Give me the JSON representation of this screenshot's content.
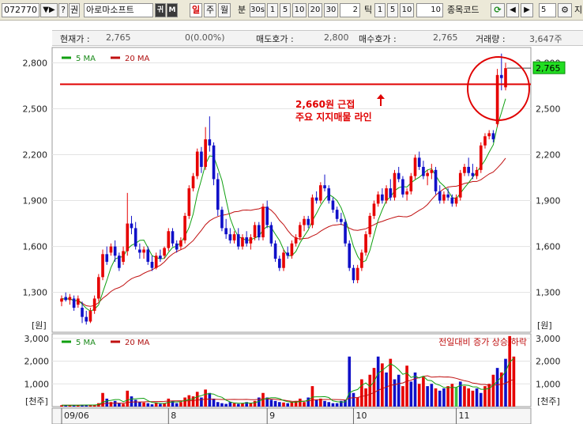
{
  "toolbar": {
    "code": "072770",
    "arrows": "▼▶",
    "help": "?",
    "right_btn": "권",
    "stock_name": "아로마소프트",
    "mode_btn": "귀",
    "menu_btn": "M",
    "period_day": "일",
    "period_week": "주",
    "period_month": "월",
    "minute_label": "분",
    "minute_options": [
      "30s",
      "1",
      "5",
      "10",
      "20",
      "30"
    ],
    "minute_value": "2",
    "tick_label": "틱",
    "tick_options": [
      "1",
      "5",
      "10"
    ],
    "tick_value": "10",
    "compare_label": "종목코드",
    "count_value": "5",
    "right_edge_label": "지"
  },
  "info": {
    "price_label": "현재가 :",
    "price": "2,765",
    "change": "0(0.00%)",
    "ask_label": "매도호가 :",
    "ask": "2,800",
    "bid_label": "매수호가 :",
    "bid": "2,765",
    "volume_label": "거래량 :",
    "volume": "3,647주"
  },
  "chart_data": [
    {
      "type": "candlestick",
      "legend": [
        "5 MA",
        "20 MA"
      ],
      "y_ticks": [
        "2,800",
        "2,500",
        "2,200",
        "1,900",
        "1,600",
        "1,300"
      ],
      "y_unit": "[원]",
      "ylim": [
        1040,
        2900
      ],
      "x_ticks": [
        "09/06",
        "8",
        "9",
        "10",
        "11"
      ],
      "last_price_tag": "2,765",
      "support_level": 2660,
      "annotation": [
        "2,660원 근접",
        "주요 지지매물 라인"
      ],
      "colors": {
        "up": "#e60000",
        "down": "#1010c8",
        "ma5": "#10a010",
        "ma20": "#c01010",
        "support": "#e00000",
        "tag_bg": "#22dd22"
      },
      "candles": [
        {
          "o": 1240,
          "h": 1280,
          "l": 1210,
          "c": 1260
        },
        {
          "o": 1270,
          "h": 1300,
          "l": 1240,
          "c": 1250
        },
        {
          "o": 1250,
          "h": 1290,
          "l": 1220,
          "c": 1270
        },
        {
          "o": 1260,
          "h": 1280,
          "l": 1180,
          "c": 1200
        },
        {
          "o": 1220,
          "h": 1280,
          "l": 1200,
          "c": 1260
        },
        {
          "o": 1200,
          "h": 1240,
          "l": 1100,
          "c": 1140
        },
        {
          "o": 1140,
          "h": 1180,
          "l": 1090,
          "c": 1110
        },
        {
          "o": 1110,
          "h": 1200,
          "l": 1100,
          "c": 1180
        },
        {
          "o": 1180,
          "h": 1280,
          "l": 1160,
          "c": 1260
        },
        {
          "o": 1260,
          "h": 1420,
          "l": 1240,
          "c": 1400
        },
        {
          "o": 1400,
          "h": 1580,
          "l": 1380,
          "c": 1550
        },
        {
          "o": 1550,
          "h": 1600,
          "l": 1480,
          "c": 1500
        },
        {
          "o": 1560,
          "h": 1620,
          "l": 1540,
          "c": 1600
        },
        {
          "o": 1600,
          "h": 1640,
          "l": 1500,
          "c": 1540
        },
        {
          "o": 1540,
          "h": 1560,
          "l": 1440,
          "c": 1460
        },
        {
          "o": 1500,
          "h": 1600,
          "l": 1480,
          "c": 1570
        },
        {
          "o": 1570,
          "h": 1950,
          "l": 1540,
          "c": 1750
        },
        {
          "o": 1750,
          "h": 1800,
          "l": 1680,
          "c": 1720
        },
        {
          "o": 1720,
          "h": 1760,
          "l": 1580,
          "c": 1600
        },
        {
          "o": 1580,
          "h": 1620,
          "l": 1520,
          "c": 1560
        },
        {
          "o": 1560,
          "h": 1600,
          "l": 1520,
          "c": 1580
        },
        {
          "o": 1580,
          "h": 1600,
          "l": 1480,
          "c": 1500
        },
        {
          "o": 1500,
          "h": 1540,
          "l": 1440,
          "c": 1460
        },
        {
          "o": 1460,
          "h": 1560,
          "l": 1450,
          "c": 1540
        },
        {
          "o": 1540,
          "h": 1580,
          "l": 1500,
          "c": 1520
        },
        {
          "o": 1540,
          "h": 1600,
          "l": 1520,
          "c": 1590
        },
        {
          "o": 1590,
          "h": 1720,
          "l": 1570,
          "c": 1700
        },
        {
          "o": 1700,
          "h": 1720,
          "l": 1600,
          "c": 1620
        },
        {
          "o": 1620,
          "h": 1640,
          "l": 1560,
          "c": 1580
        },
        {
          "o": 1600,
          "h": 1660,
          "l": 1580,
          "c": 1640
        },
        {
          "o": 1640,
          "h": 1820,
          "l": 1620,
          "c": 1800
        },
        {
          "o": 1800,
          "h": 2000,
          "l": 1780,
          "c": 1980
        },
        {
          "o": 1980,
          "h": 2080,
          "l": 1960,
          "c": 2060
        },
        {
          "o": 2060,
          "h": 2240,
          "l": 2040,
          "c": 2220
        },
        {
          "o": 2220,
          "h": 2250,
          "l": 2080,
          "c": 2120
        },
        {
          "o": 2120,
          "h": 2380,
          "l": 2100,
          "c": 2300
        },
        {
          "o": 2300,
          "h": 2450,
          "l": 2220,
          "c": 2260
        },
        {
          "o": 2260,
          "h": 2280,
          "l": 2000,
          "c": 2040
        },
        {
          "o": 2040,
          "h": 2080,
          "l": 1800,
          "c": 1840
        },
        {
          "o": 1840,
          "h": 1860,
          "l": 1700,
          "c": 1720
        },
        {
          "o": 1720,
          "h": 1780,
          "l": 1650,
          "c": 1680
        },
        {
          "o": 1680,
          "h": 1720,
          "l": 1620,
          "c": 1640
        },
        {
          "o": 1640,
          "h": 1700,
          "l": 1620,
          "c": 1680
        },
        {
          "o": 1680,
          "h": 1720,
          "l": 1580,
          "c": 1600
        },
        {
          "o": 1600,
          "h": 1680,
          "l": 1580,
          "c": 1660
        },
        {
          "o": 1660,
          "h": 1700,
          "l": 1600,
          "c": 1620
        },
        {
          "o": 1620,
          "h": 1680,
          "l": 1580,
          "c": 1660
        },
        {
          "o": 1660,
          "h": 1760,
          "l": 1640,
          "c": 1740
        },
        {
          "o": 1740,
          "h": 1760,
          "l": 1640,
          "c": 1660
        },
        {
          "o": 1660,
          "h": 1880,
          "l": 1640,
          "c": 1860
        },
        {
          "o": 1860,
          "h": 1900,
          "l": 1720,
          "c": 1740
        },
        {
          "o": 1740,
          "h": 1760,
          "l": 1600,
          "c": 1620
        },
        {
          "o": 1620,
          "h": 1640,
          "l": 1500,
          "c": 1520
        },
        {
          "o": 1520,
          "h": 1540,
          "l": 1440,
          "c": 1460
        },
        {
          "o": 1460,
          "h": 1580,
          "l": 1440,
          "c": 1560
        },
        {
          "o": 1560,
          "h": 1600,
          "l": 1520,
          "c": 1540
        },
        {
          "o": 1540,
          "h": 1640,
          "l": 1520,
          "c": 1620
        },
        {
          "o": 1620,
          "h": 1680,
          "l": 1600,
          "c": 1660
        },
        {
          "o": 1660,
          "h": 1760,
          "l": 1640,
          "c": 1740
        },
        {
          "o": 1740,
          "h": 1800,
          "l": 1700,
          "c": 1780
        },
        {
          "o": 1780,
          "h": 1800,
          "l": 1720,
          "c": 1740
        },
        {
          "o": 1740,
          "h": 1940,
          "l": 1720,
          "c": 1920
        },
        {
          "o": 1920,
          "h": 1960,
          "l": 1880,
          "c": 1900
        },
        {
          "o": 1900,
          "h": 2020,
          "l": 1880,
          "c": 2000
        },
        {
          "o": 2000,
          "h": 2070,
          "l": 1960,
          "c": 1980
        },
        {
          "o": 1980,
          "h": 2000,
          "l": 1880,
          "c": 1900
        },
        {
          "o": 1900,
          "h": 1920,
          "l": 1820,
          "c": 1840
        },
        {
          "o": 1840,
          "h": 1860,
          "l": 1760,
          "c": 1780
        },
        {
          "o": 1780,
          "h": 1820,
          "l": 1740,
          "c": 1760
        },
        {
          "o": 1760,
          "h": 1780,
          "l": 1600,
          "c": 1620
        },
        {
          "o": 1620,
          "h": 1640,
          "l": 1440,
          "c": 1460
        },
        {
          "o": 1460,
          "h": 1480,
          "l": 1360,
          "c": 1380
        },
        {
          "o": 1380,
          "h": 1480,
          "l": 1360,
          "c": 1460
        },
        {
          "o": 1460,
          "h": 1580,
          "l": 1440,
          "c": 1560
        },
        {
          "o": 1560,
          "h": 1700,
          "l": 1540,
          "c": 1680
        },
        {
          "o": 1680,
          "h": 1820,
          "l": 1660,
          "c": 1800
        },
        {
          "o": 1800,
          "h": 1900,
          "l": 1780,
          "c": 1880
        },
        {
          "o": 1880,
          "h": 1960,
          "l": 1860,
          "c": 1940
        },
        {
          "o": 1940,
          "h": 1980,
          "l": 1880,
          "c": 1900
        },
        {
          "o": 1900,
          "h": 2000,
          "l": 1880,
          "c": 1980
        },
        {
          "o": 1980,
          "h": 2040,
          "l": 1900,
          "c": 1920
        },
        {
          "o": 1920,
          "h": 2100,
          "l": 1900,
          "c": 2080
        },
        {
          "o": 2080,
          "h": 2120,
          "l": 2020,
          "c": 2040
        },
        {
          "o": 2040,
          "h": 2060,
          "l": 1920,
          "c": 1940
        },
        {
          "o": 1940,
          "h": 1980,
          "l": 1900,
          "c": 1960
        },
        {
          "o": 1960,
          "h": 2080,
          "l": 1940,
          "c": 2060
        },
        {
          "o": 2060,
          "h": 2200,
          "l": 2040,
          "c": 2180
        },
        {
          "o": 2180,
          "h": 2220,
          "l": 2100,
          "c": 2120
        },
        {
          "o": 2120,
          "h": 2160,
          "l": 2040,
          "c": 2060
        },
        {
          "o": 2060,
          "h": 2100,
          "l": 2000,
          "c": 2080
        },
        {
          "o": 2080,
          "h": 2140,
          "l": 2040,
          "c": 2100
        },
        {
          "o": 2100,
          "h": 2120,
          "l": 1940,
          "c": 1960
        },
        {
          "o": 1960,
          "h": 2000,
          "l": 1880,
          "c": 1900
        },
        {
          "o": 1900,
          "h": 1960,
          "l": 1880,
          "c": 1940
        },
        {
          "o": 1940,
          "h": 1980,
          "l": 1900,
          "c": 1920
        },
        {
          "o": 1920,
          "h": 1940,
          "l": 1860,
          "c": 1880
        },
        {
          "o": 1880,
          "h": 1940,
          "l": 1860,
          "c": 1920
        },
        {
          "o": 1920,
          "h": 2100,
          "l": 1900,
          "c": 2080
        },
        {
          "o": 2080,
          "h": 2140,
          "l": 2060,
          "c": 2120
        },
        {
          "o": 2120,
          "h": 2180,
          "l": 2060,
          "c": 2080
        },
        {
          "o": 2080,
          "h": 2140,
          "l": 2040,
          "c": 2060
        },
        {
          "o": 2060,
          "h": 2120,
          "l": 2040,
          "c": 2100
        },
        {
          "o": 2100,
          "h": 2280,
          "l": 2080,
          "c": 2260
        },
        {
          "o": 2260,
          "h": 2340,
          "l": 2240,
          "c": 2320
        },
        {
          "o": 2320,
          "h": 2360,
          "l": 2300,
          "c": 2340
        },
        {
          "o": 2340,
          "h": 2360,
          "l": 2280,
          "c": 2300
        },
        {
          "o": 2400,
          "h": 2760,
          "l": 2380,
          "c": 2720
        },
        {
          "o": 2720,
          "h": 2860,
          "l": 2620,
          "c": 2700
        },
        {
          "o": 2640,
          "h": 2800,
          "l": 2620,
          "c": 2765
        }
      ]
    },
    {
      "type": "bar",
      "legend": [
        "5 MA",
        "20 MA"
      ],
      "subtitle": "전일대비 증가 상승/하락",
      "y_ticks": [
        "3,000",
        "2,000",
        "1,000"
      ],
      "y_unit": "[천주]",
      "ylim": [
        0,
        3200
      ],
      "colors": {
        "up": "#e60000",
        "down": "#1010c8",
        "neutral": "#40c040"
      },
      "values": [
        60,
        60,
        60,
        70,
        60,
        80,
        70,
        60,
        80,
        150,
        600,
        350,
        200,
        250,
        150,
        120,
        700,
        450,
        300,
        200,
        180,
        150,
        100,
        180,
        120,
        150,
        350,
        250,
        150,
        200,
        400,
        500,
        450,
        650,
        400,
        750,
        600,
        350,
        200,
        150,
        120,
        200,
        150,
        120,
        150,
        200,
        150,
        250,
        400,
        600,
        400,
        300,
        250,
        200,
        180,
        150,
        200,
        250,
        350,
        200,
        400,
        900,
        300,
        350,
        250,
        200,
        150,
        150,
        250,
        300,
        2200,
        600,
        400,
        1200,
        800,
        1400,
        1700,
        2200,
        1900,
        1500,
        2100,
        1200,
        1400,
        900,
        1800,
        1100,
        1500,
        1000,
        1300,
        900,
        1000,
        800,
        700,
        800,
        900,
        1000,
        850,
        1100,
        900,
        800,
        700,
        800,
        600,
        900,
        1000,
        1400,
        1700,
        1500,
        2100,
        3100,
        2200
      ],
      "dirs": [
        1,
        -1,
        1,
        -1,
        1,
        -1,
        -1,
        1,
        1,
        1,
        1,
        -1,
        1,
        -1,
        -1,
        1,
        1,
        -1,
        -1,
        -1,
        1,
        -1,
        -1,
        1,
        -1,
        1,
        1,
        -1,
        -1,
        1,
        1,
        1,
        1,
        1,
        -1,
        1,
        -1,
        -1,
        -1,
        -1,
        -1,
        -1,
        1,
        -1,
        1,
        -1,
        1,
        1,
        -1,
        1,
        -1,
        -1,
        -1,
        -1,
        1,
        -1,
        1,
        1,
        1,
        1,
        -1,
        1,
        -1,
        1,
        -1,
        -1,
        -1,
        -1,
        -1,
        -1,
        -1,
        -1,
        1,
        1,
        1,
        1,
        1,
        -1,
        1,
        -1,
        1,
        -1,
        -1,
        1,
        1,
        -1,
        -1,
        1,
        1,
        -1,
        -1,
        1,
        -1,
        -1,
        1,
        1,
        0,
        -1,
        1,
        1,
        1,
        -1,
        -1,
        1,
        1,
        1,
        -1,
        1,
        -1,
        1,
        1
      ]
    }
  ]
}
